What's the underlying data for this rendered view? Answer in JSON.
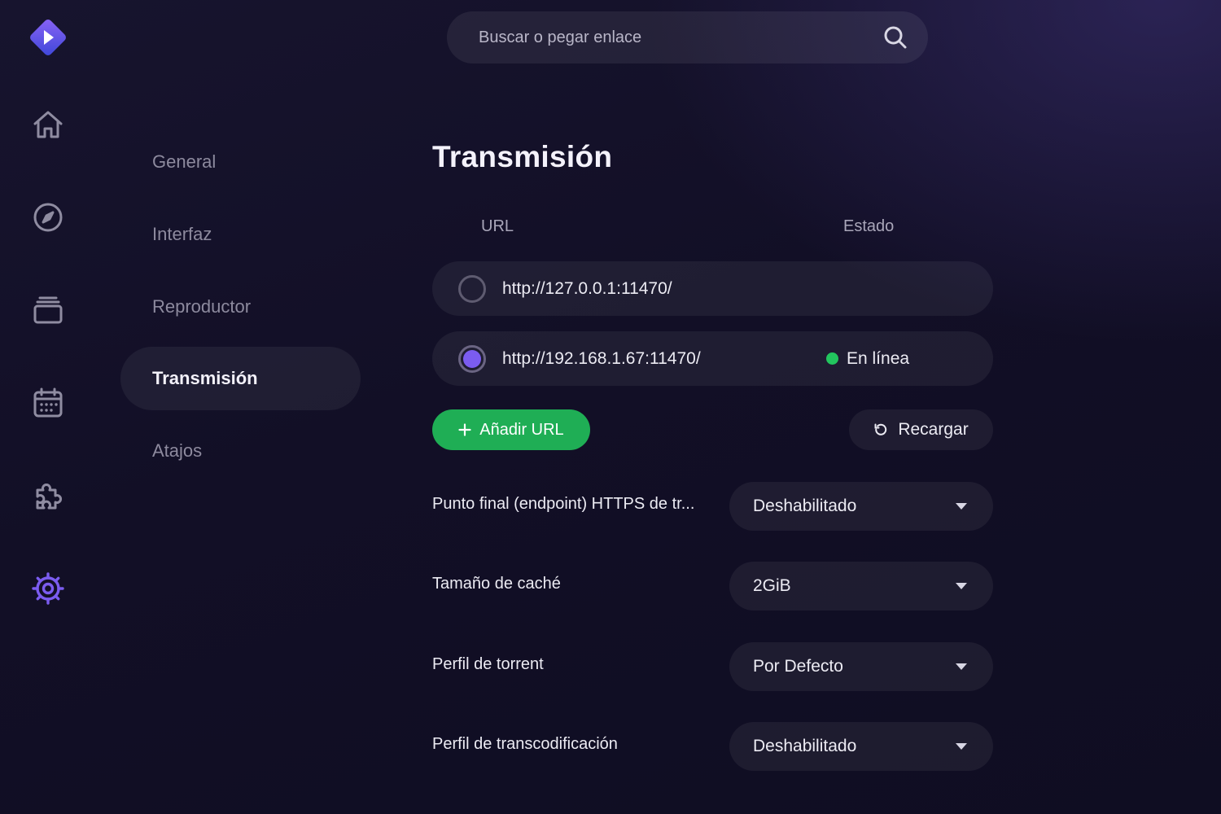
{
  "search": {
    "placeholder": "Buscar o pegar enlace"
  },
  "rail": {
    "items": [
      "home-icon",
      "discover-icon",
      "library-icon",
      "calendar-icon",
      "addons-icon",
      "settings-icon"
    ],
    "active": "settings-icon",
    "accent": "#7b5cf0"
  },
  "settings_nav": {
    "items": [
      {
        "label": "General"
      },
      {
        "label": "Interfaz"
      },
      {
        "label": "Reproductor"
      },
      {
        "label": "Transmisión",
        "active": true
      },
      {
        "label": "Atajos"
      }
    ]
  },
  "content": {
    "title": "Transmisión",
    "columns": {
      "url": "URL",
      "status": "Estado"
    },
    "servers": [
      {
        "url": "http://127.0.0.1:11470/",
        "selected": false,
        "status": ""
      },
      {
        "url": "http://192.168.1.67:11470/",
        "selected": true,
        "status": "En línea",
        "status_color": "#22c55e"
      }
    ],
    "add_url_label": "Añadir URL",
    "reload_label": "Recargar",
    "settings": [
      {
        "label": "Punto final (endpoint) HTTPS de tr...",
        "value": "Deshabilitado"
      },
      {
        "label": "Tamaño de caché",
        "value": "2GiB"
      },
      {
        "label": "Perfil de torrent",
        "value": "Por Defecto"
      },
      {
        "label": "Perfil de transcodificación",
        "value": "Deshabilitado"
      }
    ]
  },
  "colors": {
    "primary_button": "#1fae55",
    "accent": "#7b5cf0",
    "online": "#22c55e"
  }
}
